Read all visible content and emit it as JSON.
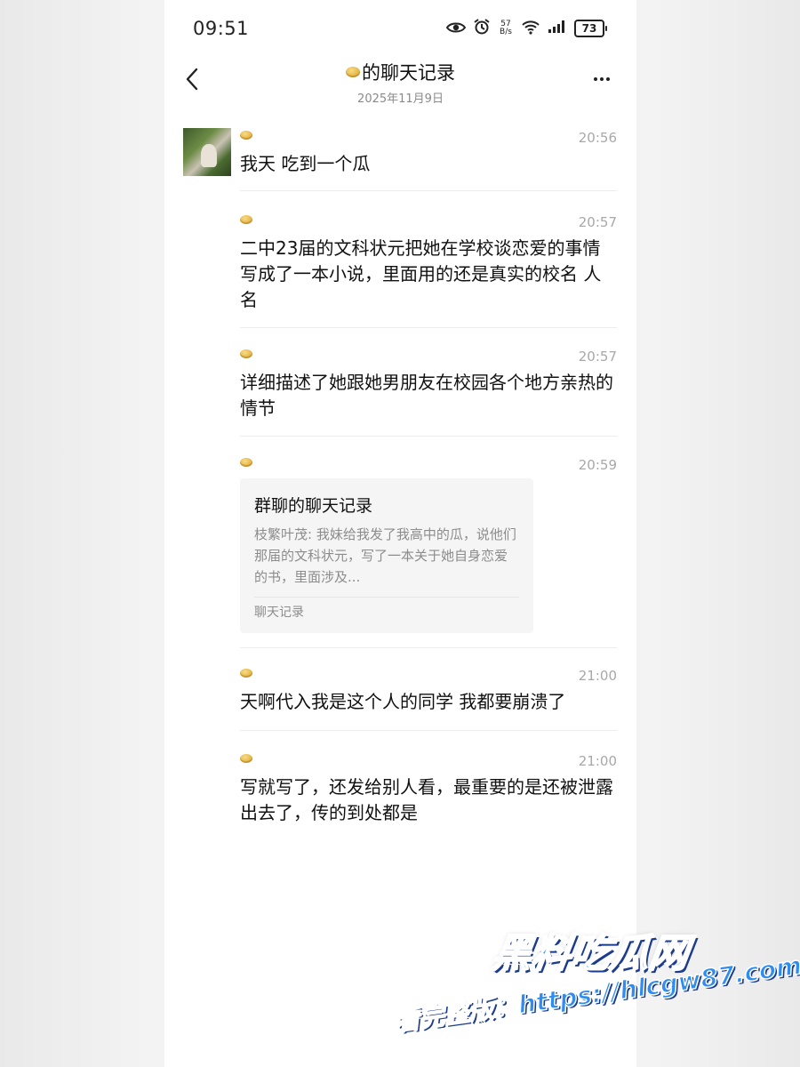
{
  "status_bar": {
    "time": "09:51",
    "net_speed_value": "57",
    "net_speed_unit": "B/s",
    "battery": "73",
    "icons": [
      "eye-icon",
      "alarm-icon",
      "wifi-icon",
      "signal-icon",
      "battery-icon"
    ]
  },
  "header": {
    "title": "的聊天记录",
    "date": "2025年11月9日",
    "title_emoji": "coin-emoji"
  },
  "messages": [
    {
      "time": "20:56",
      "text": "我天 吃到一个瓜"
    },
    {
      "time": "20:57",
      "text": "二中23届的文科状元把她在学校谈恋爱的事情写成了一本小说，里面用的还是真实的校名 人名"
    },
    {
      "time": "20:57",
      "text": "详细描述了她跟她男朋友在校园各个地方亲热的情节"
    },
    {
      "time": "20:59",
      "card": {
        "title": "群聊的聊天记录",
        "preview": "枝繁叶茂: 我妹给我发了我高中的瓜，说他们那届的文科状元，写了一本关于她自身恋爱的书，里面涉及...",
        "footer": "聊天记录"
      }
    },
    {
      "time": "21:00",
      "text": "天啊代入我是这个人的同学 我都要崩溃了"
    },
    {
      "time": "21:00",
      "text": "写就写了，还发给别人看，最重要的是还被泄露出去了，传的到处都是"
    }
  ],
  "watermark": {
    "brand": "黑料吃瓜网",
    "url_line": "看完整版：https://hlcgw87.com"
  },
  "colors": {
    "time_gray": "#a8a8a8",
    "card_bg": "#f5f5f5",
    "watermark_blue": "#2f8df2"
  }
}
